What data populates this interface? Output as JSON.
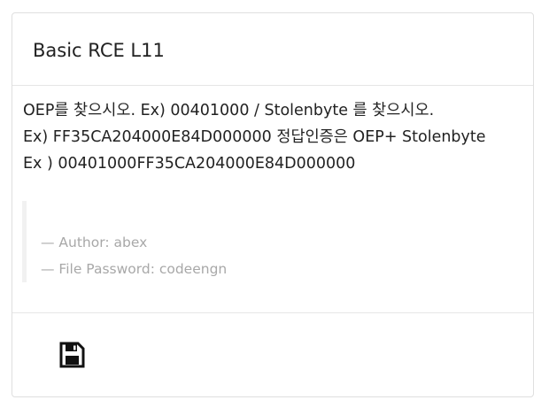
{
  "card": {
    "title": "Basic RCE L11",
    "description": [
      "OEP를 찾으시오. Ex) 00401000 / Stolenbyte 를 찾으시오.",
      "Ex) FF35CA204000E84D000000 정답인증은 OEP+ Stolenbyte",
      "Ex ) 00401000FF35CA204000E84D000000"
    ],
    "meta": {
      "author": "— Author: abex",
      "password": "— File Password: codeengn"
    },
    "footer": {
      "icon": "floppy-disk-save-icon"
    }
  }
}
